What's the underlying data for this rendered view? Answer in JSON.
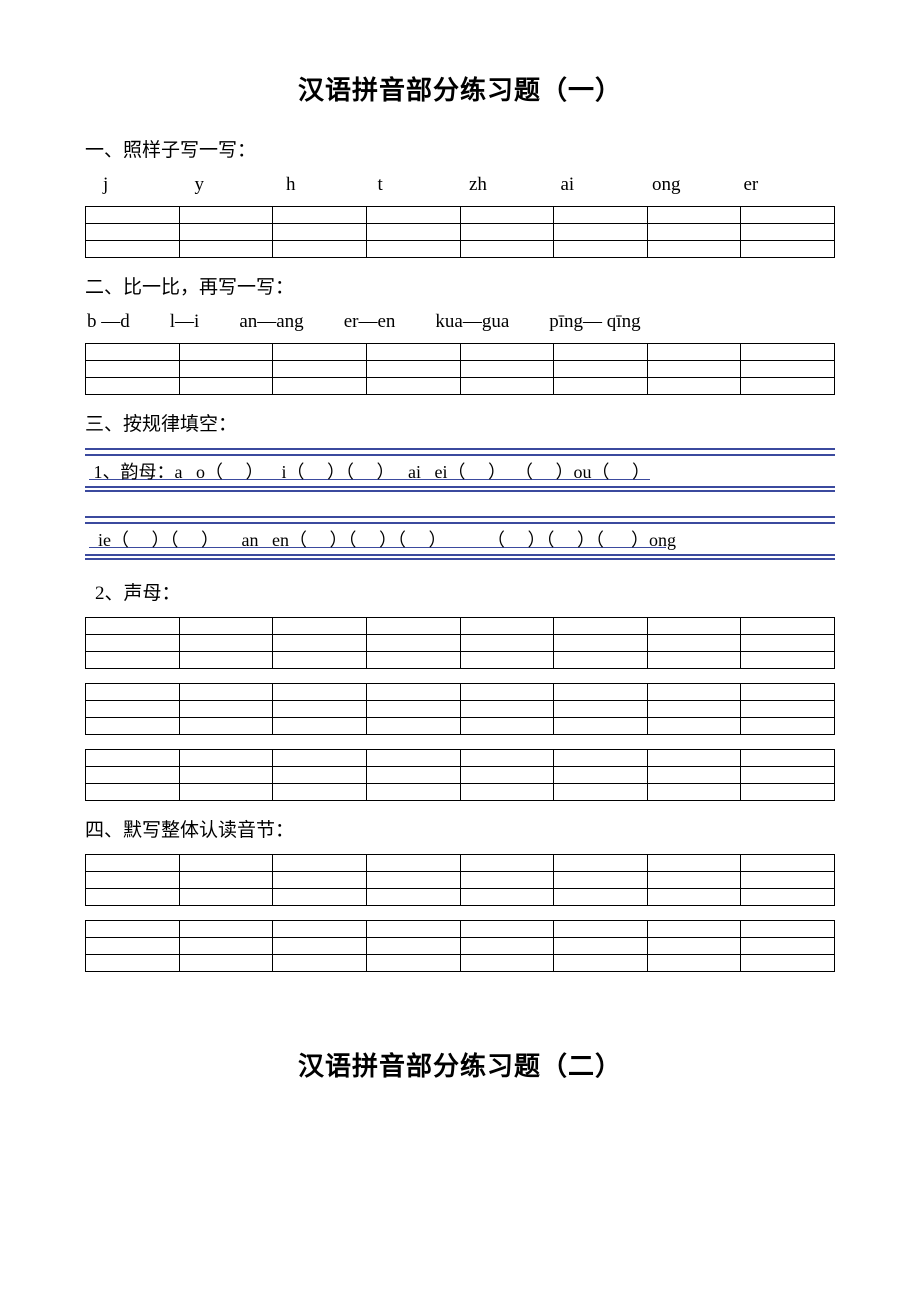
{
  "title1": "汉语拼音部分练习题（一）",
  "title2": "汉语拼音部分练习题（二）",
  "section1": {
    "heading": "一、照样子写一写：",
    "letters": [
      "j",
      "y",
      "h",
      "t",
      "zh",
      "ai",
      "ong",
      "er"
    ]
  },
  "section2": {
    "heading": "二、比一比，再写一写：",
    "pairs": [
      "b —d",
      "l—i",
      "an—ang",
      "er—en",
      "kua—gua",
      "pīng— qīng"
    ]
  },
  "section3": {
    "heading": "三、按规律填空：",
    "line1": " 1、韵母：a   o（     ）    i（     ）（     ）   ai   ei（     ）  （     ）ou（     ）",
    "line2": "  ie（     ）（     ）     an   en（     ）（     ）（     ）         （     ）（     ）（      ）ong",
    "sub": "2、声母："
  },
  "section4": {
    "heading": "四、默写整体认读音节："
  }
}
